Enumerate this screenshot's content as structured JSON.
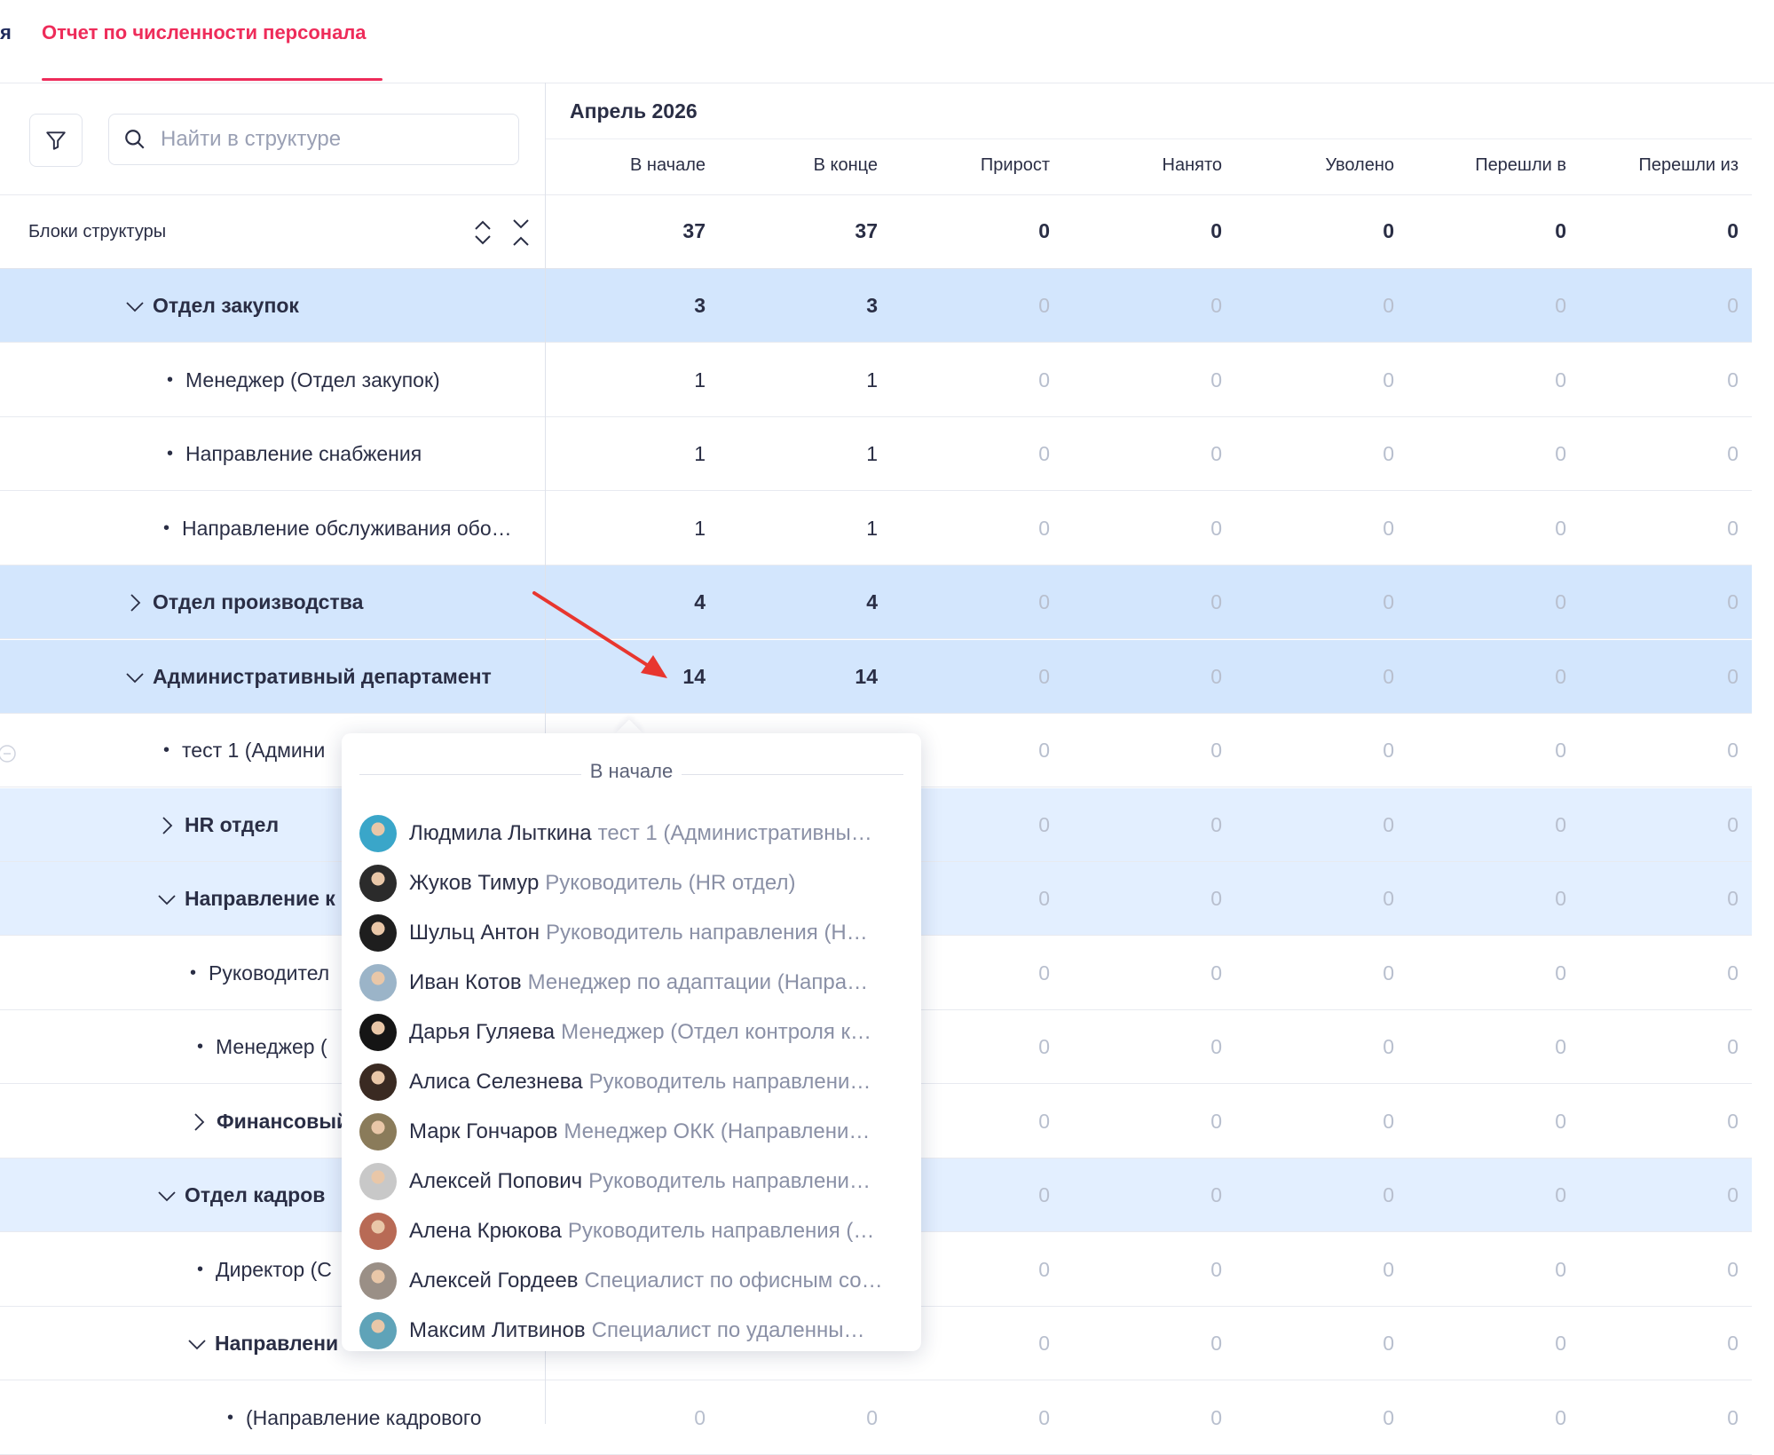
{
  "tabs": {
    "prev_fragment": "я",
    "active_label": "Отчет по численности персонала"
  },
  "search": {
    "placeholder": "Найти в структуре"
  },
  "structure": {
    "blocks_label": "Блоки структуры"
  },
  "period": {
    "month": "Апрель 2026"
  },
  "columns": [
    "В начале",
    "В конце",
    "Прирост",
    "Нанято",
    "Уволено",
    "Перешли в",
    "Перешли из"
  ],
  "totals": [
    "37",
    "37",
    "0",
    "0",
    "0",
    "0",
    "0"
  ],
  "rows": [
    {
      "label": "Отдел закупок",
      "bold": true,
      "expander": "down",
      "indent": 140,
      "bg": "hl1",
      "values": [
        "3",
        "3",
        "0",
        "0",
        "0",
        "0",
        "0"
      ]
    },
    {
      "label": "Менеджер (Отдел закупок)",
      "bold": false,
      "expander": "bullet",
      "indent": 188,
      "bg": "",
      "values": [
        "1",
        "1",
        "0",
        "0",
        "0",
        "0",
        "0"
      ]
    },
    {
      "label": "Направление снабжения",
      "bold": false,
      "expander": "bullet",
      "indent": 188,
      "bg": "",
      "values": [
        "1",
        "1",
        "0",
        "0",
        "0",
        "0",
        "0"
      ]
    },
    {
      "label": "Направление обслуживания обо…",
      "bold": false,
      "expander": "bullet",
      "indent": 184,
      "bg": "",
      "values": [
        "1",
        "1",
        "0",
        "0",
        "0",
        "0",
        "0"
      ]
    },
    {
      "label": "Отдел производства",
      "bold": true,
      "expander": "right",
      "indent": 140,
      "bg": "hl1",
      "values": [
        "4",
        "4",
        "0",
        "0",
        "0",
        "0",
        "0"
      ]
    },
    {
      "label": "Административный департамент",
      "bold": true,
      "expander": "down",
      "indent": 140,
      "bg": "hl1",
      "values": [
        "14",
        "14",
        "0",
        "0",
        "0",
        "0",
        "0"
      ]
    },
    {
      "label": "тест 1 (Админи",
      "bold": false,
      "expander": "bullet",
      "indent": 184,
      "bg": "",
      "values": [
        "",
        "",
        "0",
        "0",
        "0",
        "0",
        "0"
      ]
    },
    {
      "label": "HR отдел",
      "bold": true,
      "expander": "right",
      "indent": 176,
      "bg": "hl2",
      "values": [
        "",
        "",
        "0",
        "0",
        "0",
        "0",
        "0"
      ]
    },
    {
      "label": "Направление к",
      "bold": true,
      "expander": "down",
      "indent": 176,
      "bg": "hl2",
      "values": [
        "",
        "",
        "0",
        "0",
        "0",
        "0",
        "0"
      ]
    },
    {
      "label": "Руководител",
      "bold": false,
      "expander": "bullet",
      "indent": 214,
      "bg": "",
      "values": [
        "",
        "",
        "0",
        "0",
        "0",
        "0",
        "0"
      ]
    },
    {
      "label": "Менеджер (",
      "bold": false,
      "expander": "bullet",
      "indent": 222,
      "bg": "",
      "values": [
        "",
        "",
        "0",
        "0",
        "0",
        "0",
        "0"
      ]
    },
    {
      "label": "Финансовый",
      "bold": true,
      "expander": "right",
      "indent": 212,
      "bg": "",
      "values": [
        "",
        "",
        "0",
        "0",
        "0",
        "0",
        "0"
      ]
    },
    {
      "label": "Отдел кадров",
      "bold": true,
      "expander": "down",
      "indent": 176,
      "bg": "hl2",
      "values": [
        "",
        "",
        "0",
        "0",
        "0",
        "0",
        "0"
      ]
    },
    {
      "label": "Директор (С",
      "bold": false,
      "expander": "bullet",
      "indent": 222,
      "bg": "",
      "values": [
        "",
        "",
        "0",
        "0",
        "0",
        "0",
        "0"
      ]
    },
    {
      "label": "Направлени",
      "bold": true,
      "expander": "down",
      "indent": 210,
      "bg": "",
      "values": [
        "",
        "",
        "0",
        "0",
        "0",
        "0",
        "0"
      ]
    },
    {
      "label": "(Направление кадрового",
      "bold": false,
      "expander": "bullet",
      "indent": 256,
      "bg": "",
      "values": [
        "0",
        "0",
        "0",
        "0",
        "0",
        "0",
        "0"
      ]
    }
  ],
  "popup": {
    "title": "В начале",
    "people": [
      {
        "name": "Людмила Лыткина",
        "role": "тест 1 (Административны…",
        "avatar_color": "#3aa6c9"
      },
      {
        "name": "Жуков Тимур",
        "role": "Руководитель (HR отдел)",
        "avatar_color": "#2b2b2b"
      },
      {
        "name": "Шульц Антон",
        "role": "Руководитель направления (Н…",
        "avatar_color": "#1e1e1e"
      },
      {
        "name": "Иван Котов",
        "role": "Менеджер по адаптации (Напра…",
        "avatar_color": "#9bb4c8"
      },
      {
        "name": "Дарья Гуляева",
        "role": "Менеджер (Отдел контроля к…",
        "avatar_color": "#151515"
      },
      {
        "name": "Алиса Селезнева",
        "role": "Руководитель направлени…",
        "avatar_color": "#3a2a22"
      },
      {
        "name": "Марк Гончаров",
        "role": "Менеджер ОКК (Направлени…",
        "avatar_color": "#8a7b5a"
      },
      {
        "name": "Алексей Попович",
        "role": "Руководитель направлени…",
        "avatar_color": "#c8c8c8"
      },
      {
        "name": "Алена Крюкова",
        "role": "Руководитель направления (…",
        "avatar_color": "#b86a55"
      },
      {
        "name": "Алексей Гордеев",
        "role": "Специалист по офисным со…",
        "avatar_color": "#9a8f86"
      },
      {
        "name": "Максим Литвинов",
        "role": "Специалист по удаленны…",
        "avatar_color": "#5fa3b8"
      }
    ]
  },
  "colors": {
    "accent": "#ee2c5a",
    "row_highlight": "#d3e6fd",
    "row_highlight_light": "#e3efff",
    "muted": "#b8bfce",
    "arrow": "#e8362f"
  },
  "icons": [
    "filter-icon",
    "search-icon",
    "sort-toggle-icon",
    "collapse-all-icon",
    "chevron-down-icon",
    "chevron-right-icon"
  ]
}
